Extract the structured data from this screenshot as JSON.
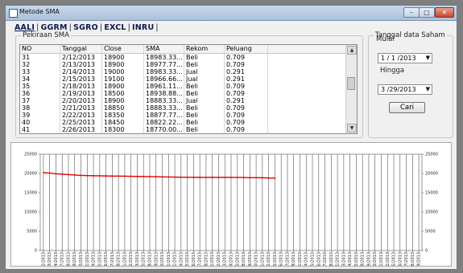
{
  "window": {
    "title": "Metode SMA"
  },
  "tabs": [
    {
      "label": "AALI"
    },
    {
      "label": "GGRM"
    },
    {
      "label": "SGRO"
    },
    {
      "label": "EXCL"
    },
    {
      "label": "INRU"
    }
  ],
  "sma_group": {
    "label": "Pekiraan SMA",
    "columns": [
      "NO",
      "Tanggal",
      "Close",
      "SMA",
      "Rekom",
      "Peluang"
    ],
    "rows": [
      [
        "31",
        "2/12/2013",
        "18900",
        "18983.33...",
        "Beli",
        "0.709"
      ],
      [
        "32",
        "2/13/2013",
        "18900",
        "18977.77...",
        "Beli",
        "0.709"
      ],
      [
        "33",
        "2/14/2013",
        "19000",
        "18983.33...",
        "Jual",
        "0.291"
      ],
      [
        "34",
        "2/15/2013",
        "19100",
        "18966.66...",
        "Jual",
        "0.291"
      ],
      [
        "35",
        "2/18/2013",
        "18900",
        "18961.11...",
        "Beli",
        "0.709"
      ],
      [
        "36",
        "2/19/2013",
        "18500",
        "18938.88...",
        "Beli",
        "0.709"
      ],
      [
        "37",
        "2/20/2013",
        "18900",
        "18883.33...",
        "Jual",
        "0.291"
      ],
      [
        "38",
        "2/21/2013",
        "18850",
        "18883.33...",
        "Beli",
        "0.709"
      ],
      [
        "39",
        "2/22/2013",
        "18350",
        "18877.77...",
        "Beli",
        "0.709"
      ],
      [
        "40",
        "2/25/2013",
        "18450",
        "18822.22...",
        "Beli",
        "0.709"
      ],
      [
        "41",
        "2/26/2013",
        "18300",
        "18770.00...",
        "Beli",
        "0.709"
      ]
    ]
  },
  "date_group": {
    "label": "Tanggal data Saham",
    "mulai_label": "Mulai",
    "mulai_value": "1 / 1 /2013",
    "hingga_label": "Hingga",
    "hingga_value": "3 /29/2013",
    "cari_label": "Cari"
  },
  "chart_data": {
    "type": "line",
    "ylim": [
      0,
      25000
    ],
    "y_ticks": [
      0,
      5000,
      10000,
      15000,
      20000,
      25000
    ],
    "grid": "vertical",
    "x_categories": [
      "1/2/2013",
      "1/3/2013",
      "1/4/2013",
      "1/7/2013",
      "1/8/2013",
      "1/9/2013",
      "1/10/2013",
      "1/11/2013",
      "1/14/2013",
      "1/15/2013",
      "1/16/2013",
      "1/17/2013",
      "1/18/2013",
      "1/21/2013",
      "1/22/2013",
      "1/23/2013",
      "1/25/2013",
      "1/28/2013",
      "1/29/2013",
      "1/30/2013",
      "1/31/2013",
      "2/1/2013",
      "2/4/2013",
      "2/5/2013",
      "2/6/2013",
      "2/7/2013",
      "2/8/2013",
      "2/11/2013",
      "2/12/2013",
      "2/13/2013",
      "2/14/2013",
      "2/15/2013",
      "2/18/2013",
      "2/19/2013",
      "2/20/2013",
      "2/21/2013",
      "2/22/2013",
      "2/25/2013",
      "2/26/2013",
      "2/27/2013",
      "2/28/2013",
      "3/1/2013",
      "3/4/2013",
      "3/5/2013",
      "3/6/2013",
      "3/7/2013",
      "3/8/2013",
      "3/11/2013",
      "3/13/2013",
      "3/14/2013",
      "3/15/2013",
      "3/18/2013",
      "3/19/2013",
      "3/20/2013",
      "3/21/2013",
      "3/22/2013",
      "3/25/2013",
      "3/26/2013",
      "3/27/2013",
      "3/28/2013",
      "3/29/2013"
    ],
    "series": [
      {
        "color": "#e00000",
        "values": [
          20200,
          20100,
          19900,
          19800,
          19700,
          19600,
          19500,
          19450,
          19400,
          19380,
          19350,
          19320,
          19300,
          19280,
          19250,
          19230,
          19200,
          19180,
          19150,
          19100,
          19080,
          19050,
          19020,
          19000,
          18990,
          18985,
          18980,
          18983,
          18978,
          18983,
          18967,
          18961,
          18939,
          18883,
          18883,
          18878,
          18822,
          18770
        ]
      }
    ]
  }
}
